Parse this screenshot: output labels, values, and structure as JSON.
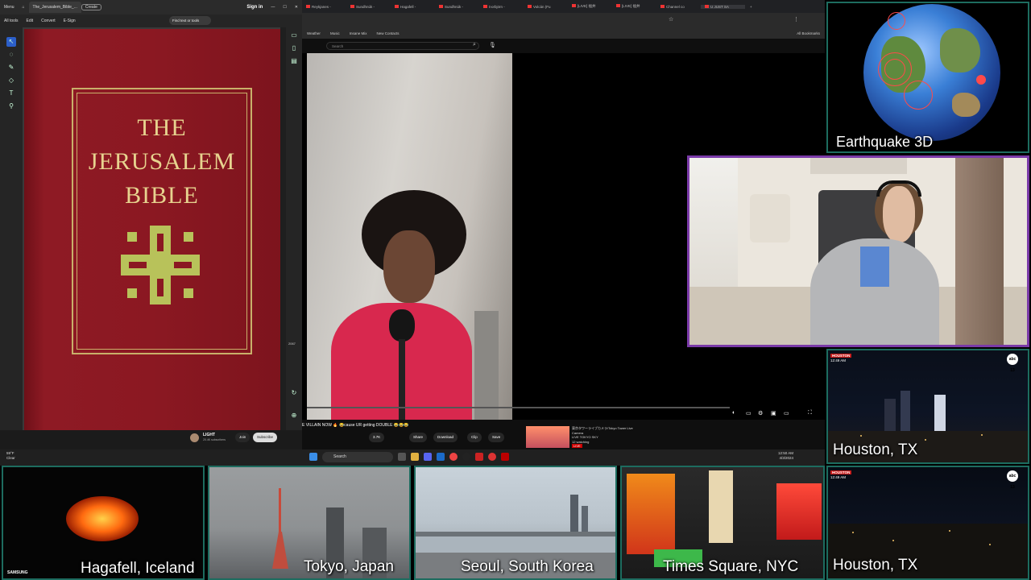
{
  "acrobat": {
    "menu_label": "Menu",
    "tab_title": "The_Jerusalem_Bible_...",
    "create_label": "Create",
    "sign_in": "Sign in",
    "menus": [
      "All tools",
      "Edit",
      "Convert",
      "E-Sign"
    ],
    "find_placeholder": "Find text or tools",
    "zoom_value": "2067"
  },
  "book_cover": {
    "line1": "THE",
    "line2": "JERUSALEM",
    "line3": "BIBLE"
  },
  "chrome": {
    "tabs": [
      "Reykjanes -",
      "Sundhnúk -",
      "Hagafell -",
      "Sundhnúk -",
      "Þorbjörn -",
      "Volcán (Fu",
      "[LIVE] 福井",
      "[LIVE] 福井",
      "Channel co",
      "U JUST SA"
    ],
    "bookmarks": [
      "Weather",
      "Music",
      "Insane Mix",
      "New Contacts"
    ],
    "all_bookmarks": "All Bookmarks"
  },
  "youtube": {
    "search_placeholder": "Search",
    "video_title": "E VILLAIN NOW 🔥 😂cause UR getting DOUBLE 😂😂😂",
    "channel_name": "LIGHT",
    "channel_subs": "20.4K subscribers",
    "join_label": "Join",
    "subscribe_label": "Subscribe",
    "likes": "3.7K",
    "share_label": "Share",
    "download_label": "Download",
    "clip_label": "Clip",
    "save_label": "Save",
    "rec_title": "東京タワーライブカメラ/Tokyo Tower Live Camera",
    "rec_channel": "LIVE TOKYO SKY",
    "rec_watching": "12 watching",
    "rec_badge": "LIVE"
  },
  "taskbar": {
    "temp": "59°F",
    "condition": "Clear",
    "search_label": "Search",
    "time": "12:50 AM",
    "date": "4/3/2024"
  },
  "tiles": {
    "earthquake": "Earthquake 3D",
    "houston_top": "Houston, TX",
    "houston_bottom": "Houston, TX",
    "iceland": "Hagafell, Iceland",
    "tokyo": "Tokyo, Japan",
    "seoul": "Seoul, South Korea",
    "times_square": "Times Square, NYC",
    "news_station": "HOUSTON",
    "news_time_top": "12:49 AM",
    "news_time_bottom": "12:49 AM",
    "abc_logo": "abc 13",
    "samsung_logo": "SAMSUNG"
  },
  "colors": {
    "tile_border": "#1d6c5f",
    "webcam_border": "#7a3aa8",
    "bible_red": "#8b1822",
    "bible_gold": "#c9b06a"
  }
}
